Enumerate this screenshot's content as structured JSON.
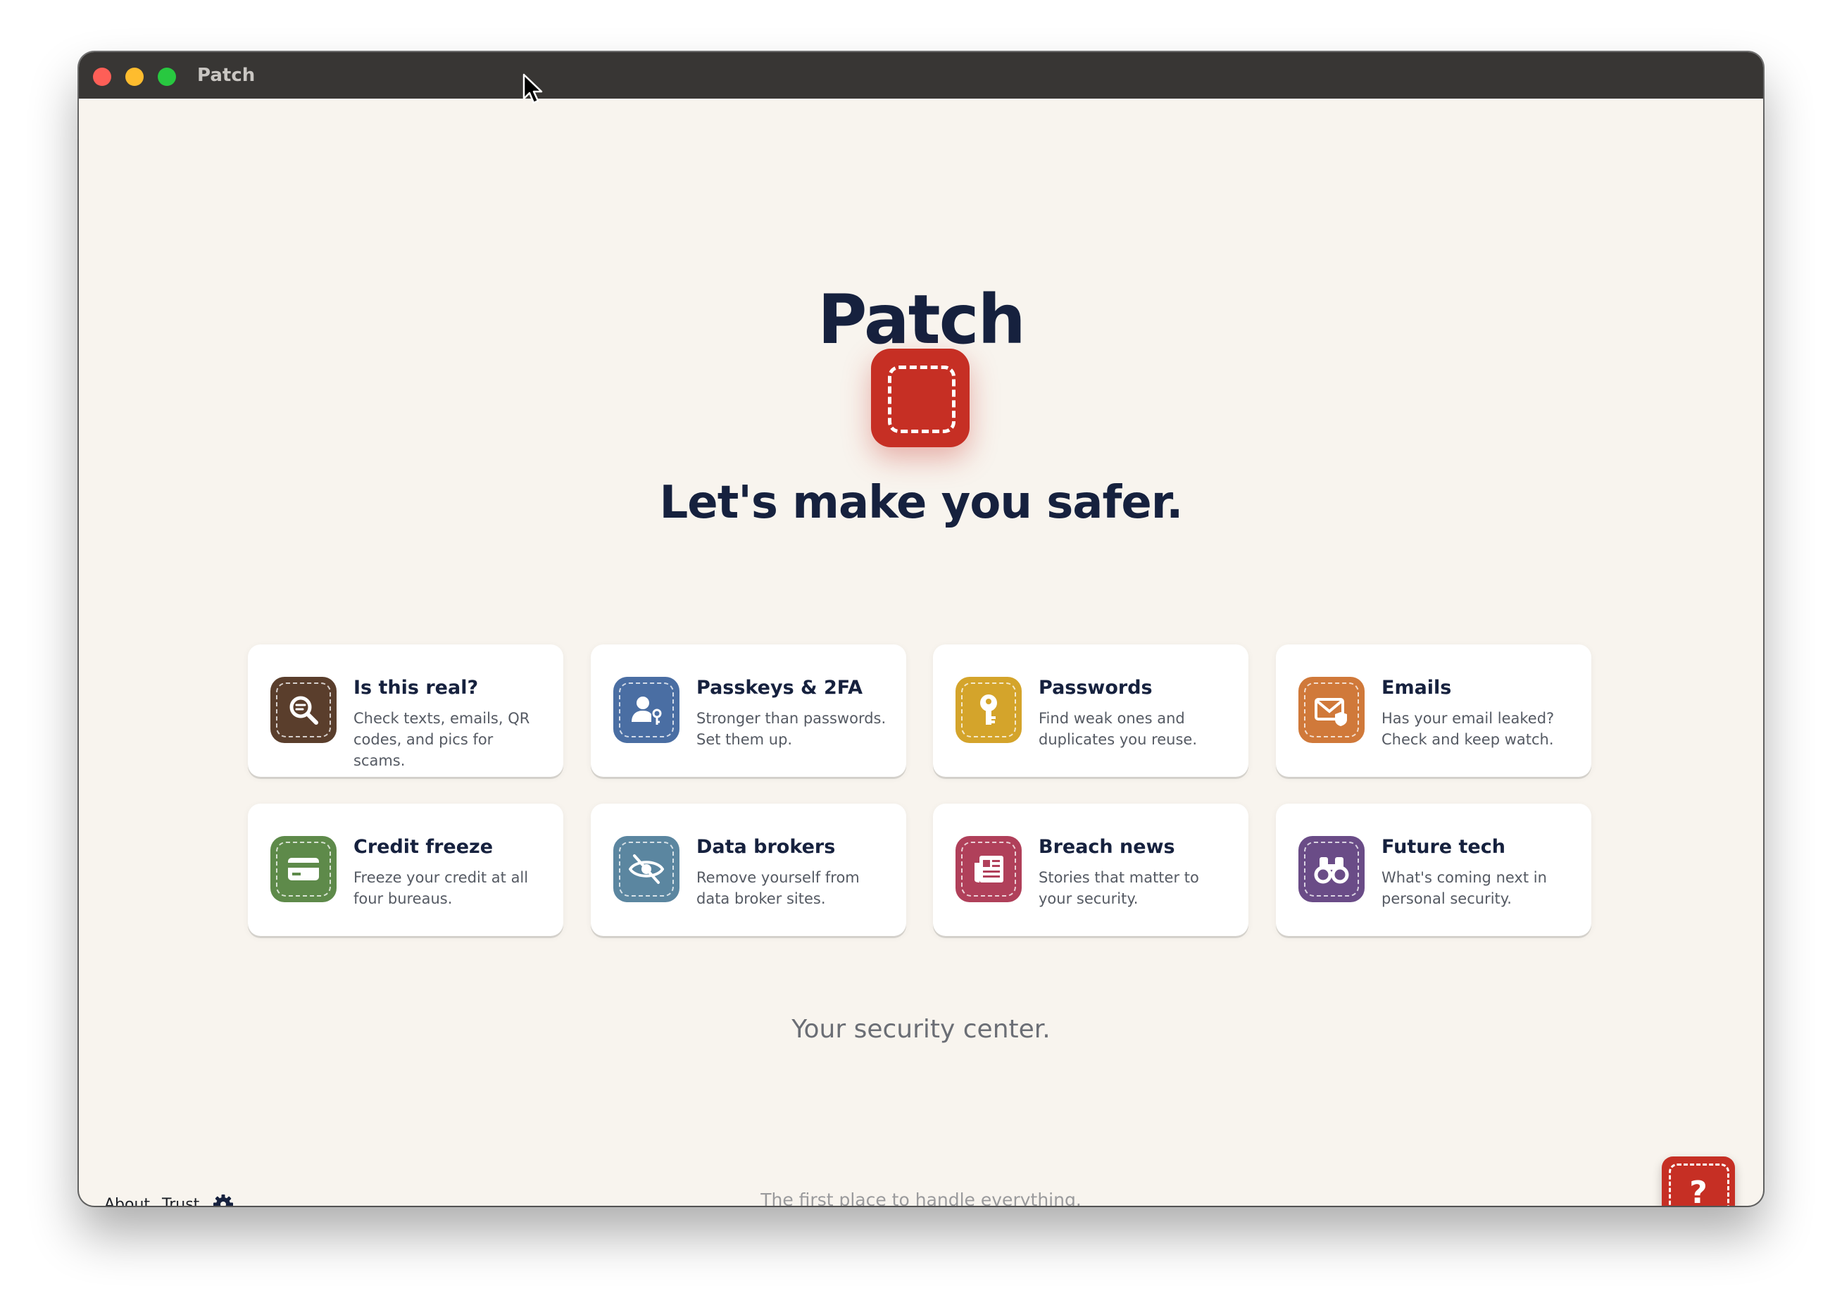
{
  "window": {
    "title": "Patch"
  },
  "hero": {
    "app_name": "Patch",
    "headline": "Let's make you safer."
  },
  "cards": [
    {
      "title": "Is this real?",
      "desc": "Check texts, emails, QR codes, and pics for scams.",
      "icon": "magnifier-scan-icon",
      "color": "#5a3e2c"
    },
    {
      "title": "Passkeys & 2FA",
      "desc": "Stronger than passwords. Set them up.",
      "icon": "user-key-icon",
      "color": "#4a6ea3"
    },
    {
      "title": "Passwords",
      "desc": "Find weak ones and duplicates you reuse.",
      "icon": "key-icon",
      "color": "#d4a42b"
    },
    {
      "title": "Emails",
      "desc": "Has your email leaked? Check and keep watch.",
      "icon": "envelope-shield-icon",
      "color": "#d0793a"
    },
    {
      "title": "Credit freeze",
      "desc": "Freeze your credit at all four bureaus.",
      "icon": "credit-card-icon",
      "color": "#5e8a4a"
    },
    {
      "title": "Data brokers",
      "desc": "Remove yourself from data broker sites.",
      "icon": "eye-slash-icon",
      "color": "#5b86a0"
    },
    {
      "title": "Breach news",
      "desc": "Stories that matter to your security.",
      "icon": "newspaper-icon",
      "color": "#b0405a"
    },
    {
      "title": "Future tech",
      "desc": "What's coming next in personal security.",
      "icon": "binoculars-icon",
      "color": "#6a4c87"
    }
  ],
  "tagline": "Your security center.",
  "footer": {
    "about": "About",
    "trust": "Trust",
    "note": "The first place to handle everything."
  },
  "help_button": {
    "label": "?"
  },
  "colors": {
    "accent": "#c62f24",
    "navy": "#16213e",
    "background": "#f8f4ee"
  }
}
